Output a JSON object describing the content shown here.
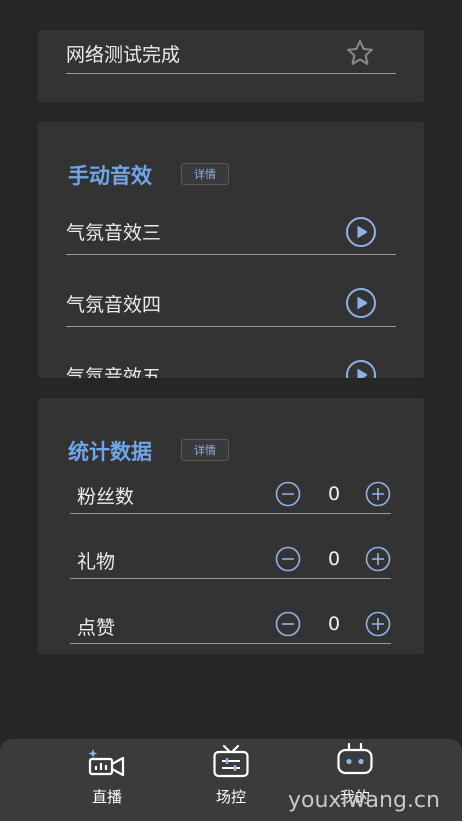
{
  "card_top": {
    "partial_row_label": "网络测试完成"
  },
  "sound_effects": {
    "title": "手动音效",
    "detail_label": "详情",
    "items": [
      {
        "label": "气氛音效三"
      },
      {
        "label": "气氛音效四"
      },
      {
        "label": "气氛音效五"
      }
    ]
  },
  "statistics": {
    "title": "统计数据",
    "detail_label": "详情",
    "items": [
      {
        "label": "粉丝数",
        "value": "0"
      },
      {
        "label": "礼物",
        "value": "0"
      },
      {
        "label": "点赞",
        "value": "0"
      }
    ]
  },
  "tabbar": {
    "tabs": [
      {
        "label": "直播",
        "icon": "live-camera-icon"
      },
      {
        "label": "场控",
        "icon": "tv-control-icon"
      },
      {
        "label": "我的",
        "icon": "robot-face-icon"
      }
    ]
  },
  "watermark": "youxiwang.cn",
  "colors": {
    "accent": "#6fa6ea",
    "background": "#262626",
    "card": "#333333",
    "tabbar": "#3b3b3b"
  }
}
